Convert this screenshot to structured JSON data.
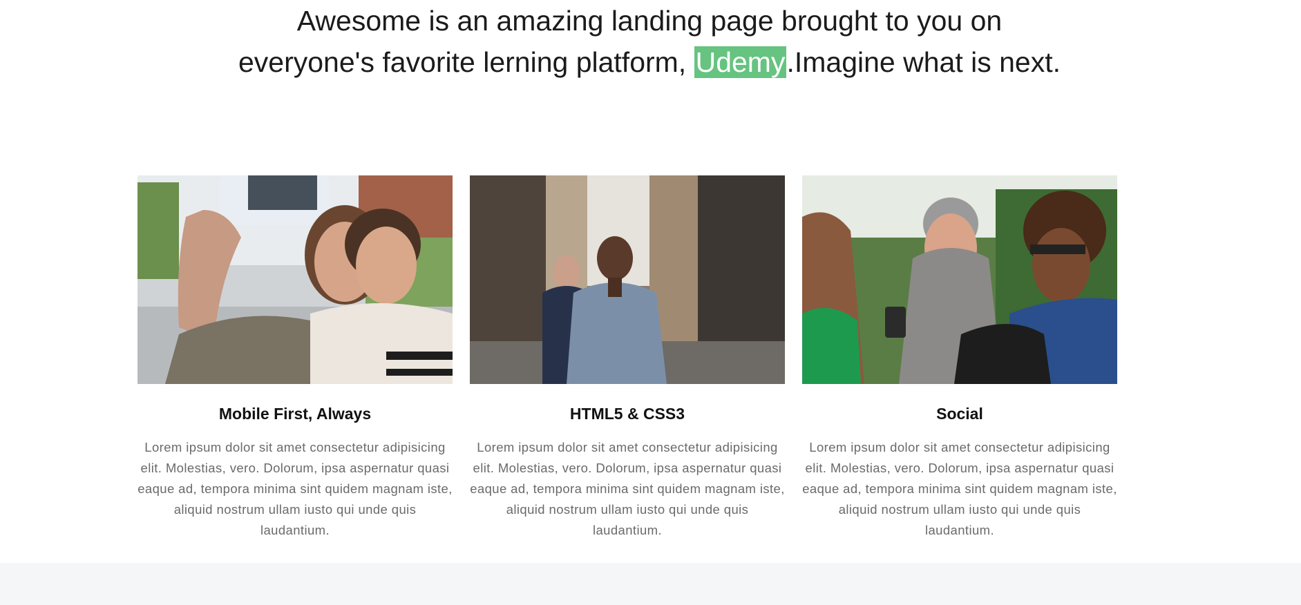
{
  "intro": {
    "before": "Awesome is an amazing landing page brought to you on everyone's favorite lerning platform, ",
    "highlight": "Udemy",
    "after": ".Imagine what is next."
  },
  "cards": [
    {
      "title": "Mobile First, Always",
      "text": "Lorem ipsum dolor sit amet consectetur adipisicing elit. Molestias, vero. Dolorum, ipsa aspernatur quasi eaque ad, tempora minima sint quidem magnam iste, aliquid nostrum ullam iusto qui unde quis laudantium.",
      "image": "couple-selfie-photo"
    },
    {
      "title": "HTML5 & CSS3",
      "text": "Lorem ipsum dolor sit amet consectetur adipisicing elit. Molestias, vero. Dolorum, ipsa aspernatur quasi eaque ad, tempora minima sint quidem magnam iste, aliquid nostrum ullam iusto qui unde quis laudantium.",
      "image": "runners-street-photo"
    },
    {
      "title": "Social",
      "text": "Lorem ipsum dolor sit amet consectetur adipisicing elit. Molestias, vero. Dolorum, ipsa aspernatur quasi eaque ad, tempora minima sint quidem magnam iste, aliquid nostrum ullam iusto qui unde quis laudantium.",
      "image": "friends-phone-photo"
    }
  ],
  "colors": {
    "highlight_bg": "#66c380",
    "text_dark": "#1b1b1b",
    "text_muted": "#6a6a6a",
    "band_bg": "#f5f6f8"
  }
}
